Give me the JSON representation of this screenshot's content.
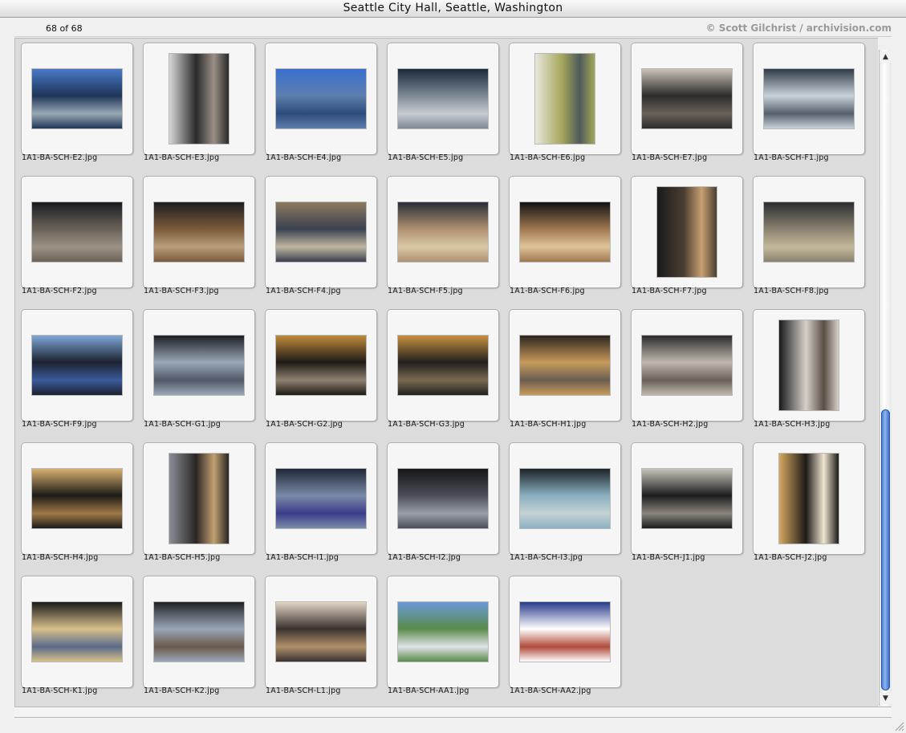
{
  "window": {
    "title": "Seattle City Hall, Seattle, Washington"
  },
  "info": {
    "count": "68 of 68",
    "copyright": "© Scott Gilchrist / archivision.com"
  },
  "thumbnails": [
    {
      "file": "1A1-BA-SCH-E2.jpg",
      "orientation": "landscape",
      "colors": [
        "#4a78c8",
        "#1e3558",
        "#9aa8b4"
      ]
    },
    {
      "file": "1A1-BA-SCH-E3.jpg",
      "orientation": "portrait",
      "colors": [
        "#d8d8d8",
        "#2a2a2a",
        "#9a8f86"
      ]
    },
    {
      "file": "1A1-BA-SCH-E4.jpg",
      "orientation": "landscape",
      "colors": [
        "#3a6fcf",
        "#5d7fae",
        "#2e4b7a"
      ]
    },
    {
      "file": "1A1-BA-SCH-E5.jpg",
      "orientation": "landscape",
      "colors": [
        "#1b2a3d",
        "#7d8896",
        "#c9cbd0"
      ]
    },
    {
      "file": "1A1-BA-SCH-E6.jpg",
      "orientation": "portrait",
      "colors": [
        "#e9e6dc",
        "#a4a85a",
        "#4e5a5a"
      ]
    },
    {
      "file": "1A1-BA-SCH-E7.jpg",
      "orientation": "landscape",
      "colors": [
        "#c9c2b8",
        "#2b2b2b",
        "#6a6259"
      ]
    },
    {
      "file": "1A1-BA-SCH-F1.jpg",
      "orientation": "landscape",
      "colors": [
        "#2f3a48",
        "#c8d2da",
        "#56606c"
      ]
    },
    {
      "file": "1A1-BA-SCH-F2.jpg",
      "orientation": "landscape",
      "colors": [
        "#1a1c22",
        "#6a6258",
        "#9c9384"
      ]
    },
    {
      "file": "1A1-BA-SCH-F3.jpg",
      "orientation": "landscape",
      "colors": [
        "#1e1e22",
        "#7a5a3a",
        "#b9a07a"
      ]
    },
    {
      "file": "1A1-BA-SCH-F4.jpg",
      "orientation": "landscape",
      "colors": [
        "#8c7a5e",
        "#3a4050",
        "#c0b7a2"
      ]
    },
    {
      "file": "1A1-BA-SCH-F5.jpg",
      "orientation": "landscape",
      "colors": [
        "#2a2e38",
        "#b09070",
        "#d8c8a6"
      ]
    },
    {
      "file": "1A1-BA-SCH-F6.jpg",
      "orientation": "landscape",
      "colors": [
        "#121214",
        "#a07850",
        "#e0c49a"
      ]
    },
    {
      "file": "1A1-BA-SCH-F7.jpg",
      "orientation": "portrait",
      "colors": [
        "#1a1a1a",
        "#4a3e32",
        "#c8a070"
      ]
    },
    {
      "file": "1A1-BA-SCH-F8.jpg",
      "orientation": "landscape",
      "colors": [
        "#2a2c30",
        "#8a8270",
        "#c6b89a"
      ]
    },
    {
      "file": "1A1-BA-SCH-F9.jpg",
      "orientation": "landscape",
      "colors": [
        "#7ea6d8",
        "#1c2230",
        "#3a5a9a"
      ]
    },
    {
      "file": "1A1-BA-SCH-G1.jpg",
      "orientation": "landscape",
      "colors": [
        "#1c1e24",
        "#9aa8b8",
        "#505866"
      ]
    },
    {
      "file": "1A1-BA-SCH-G2.jpg",
      "orientation": "landscape",
      "colors": [
        "#c08a3a",
        "#1e1a16",
        "#8e8270"
      ]
    },
    {
      "file": "1A1-BA-SCH-G3.jpg",
      "orientation": "landscape",
      "colors": [
        "#c8903e",
        "#20201e",
        "#7a6a50"
      ]
    },
    {
      "file": "1A1-BA-SCH-H1.jpg",
      "orientation": "landscape",
      "colors": [
        "#2a241e",
        "#c89a5a",
        "#6a5e52"
      ]
    },
    {
      "file": "1A1-BA-SCH-H2.jpg",
      "orientation": "landscape",
      "colors": [
        "#2c2a2a",
        "#c0b8ae",
        "#6a6058"
      ]
    },
    {
      "file": "1A1-BA-SCH-H3.jpg",
      "orientation": "portrait",
      "colors": [
        "#1a1a1c",
        "#d6d0c8",
        "#5a4e44"
      ]
    },
    {
      "file": "1A1-BA-SCH-H4.jpg",
      "orientation": "landscape",
      "colors": [
        "#d8b070",
        "#1c1a18",
        "#a07a48"
      ]
    },
    {
      "file": "1A1-BA-SCH-H5.jpg",
      "orientation": "portrait",
      "colors": [
        "#8a8e98",
        "#2a2624",
        "#c2a070"
      ]
    },
    {
      "file": "1A1-BA-SCH-I1.jpg",
      "orientation": "landscape",
      "colors": [
        "#202838",
        "#7a8aa8",
        "#3a3c8a"
      ]
    },
    {
      "file": "1A1-BA-SCH-I2.jpg",
      "orientation": "landscape",
      "colors": [
        "#151618",
        "#4a4e56",
        "#9aa0a8"
      ]
    },
    {
      "file": "1A1-BA-SCH-I3.jpg",
      "orientation": "landscape",
      "colors": [
        "#1c2228",
        "#8ab0c0",
        "#c6d2d6"
      ]
    },
    {
      "file": "1A1-BA-SCH-J1.jpg",
      "orientation": "landscape",
      "colors": [
        "#c8c4bc",
        "#1c1c1e",
        "#8a857c"
      ]
    },
    {
      "file": "1A1-BA-SCH-J2.jpg",
      "orientation": "portrait",
      "colors": [
        "#d8a860",
        "#1c1a18",
        "#f0e6d0"
      ]
    },
    {
      "file": "1A1-BA-SCH-K1.jpg",
      "orientation": "landscape",
      "colors": [
        "#1a1a1c",
        "#d8c08a",
        "#5a6a8a"
      ]
    },
    {
      "file": "1A1-BA-SCH-K2.jpg",
      "orientation": "landscape",
      "colors": [
        "#202226",
        "#9aa6b6",
        "#6a5a4a"
      ]
    },
    {
      "file": "1A1-BA-SCH-L1.jpg",
      "orientation": "landscape",
      "colors": [
        "#e2d6c4",
        "#3a3230",
        "#b0906a"
      ]
    },
    {
      "file": "1A1-BA-SCH-AA1.jpg",
      "orientation": "landscape",
      "colors": [
        "#6a9ad8",
        "#5a8a4a",
        "#e0e4e8"
      ]
    },
    {
      "file": "1A1-BA-SCH-AA2.jpg",
      "orientation": "landscape",
      "colors": [
        "#2a3a8a",
        "#ffffff",
        "#b04a3a"
      ]
    }
  ],
  "scrollbar": {
    "position": 0.52,
    "visible_fraction": 0.44
  }
}
